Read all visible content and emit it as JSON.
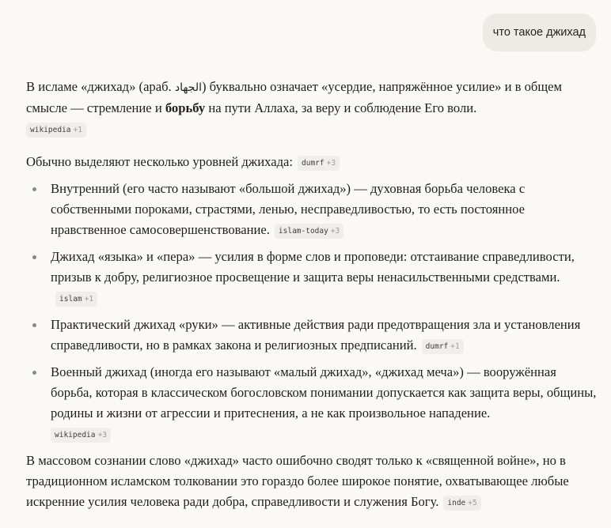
{
  "user_message": "что такое джихад",
  "answer": {
    "intro": {
      "text_1": "В исламе «джихад» (араб. ",
      "arabic": "الجهاد",
      "text_2": ") буквально означает «усердие, напряжённое усилие» и в общем смысле — стремление и ",
      "bold": "борьбу",
      "text_3": " на пути Аллаха, за веру и соблюдение Его воли.",
      "citation": {
        "source": "wikipedia",
        "more": "+1"
      }
    },
    "levels_intro": {
      "text": "Обычно выделяют несколько уровней джихада:",
      "citation": {
        "source": "dumrf",
        "more": "+3"
      }
    },
    "levels": [
      {
        "text": "Внутренний (его часто называют «большой джихад») — духовная борьба человека с собственными пороками, страстями, ленью, несправедливостью, то есть постоянное нравственное самосовершенствование.",
        "citation": {
          "source": "islam-today",
          "more": "+3"
        }
      },
      {
        "text": "Джихад «языка» и «пера» — усилия в форме слов и проповеди: отстаивание справедливости, призыв к добру, религиозное просвещение и защита веры ненасильственными средствами.",
        "citation": {
          "source": "islam",
          "more": "+1"
        }
      },
      {
        "text": "Практический джихад «руки» — активные действия ради предотвращения зла и установления справедливости, но в рамках закона и религиозных предписаний.",
        "citation": {
          "source": "dumrf",
          "more": "+1"
        }
      },
      {
        "text": "Военный джихад (иногда его называют «малый джихад», «джихад меча») — вооружённая борьба, которая в классическом богословском понимании допускается как защита веры, общины, родины и жизни от агрессии и притеснения, а не как произвольное нападение.",
        "citation": {
          "source": "wikipedia",
          "more": "+3"
        }
      }
    ],
    "outro": {
      "text": "В массовом сознании слово «джихад» часто ошибочно сводят только к «священной войне», но в традиционном исламском толковании это гораздо более широкое понятие, охватывающее любые искренние усилия человека ради добра, справедливости и служения Богу.",
      "citation": {
        "source": "inde",
        "more": "+5"
      }
    }
  }
}
